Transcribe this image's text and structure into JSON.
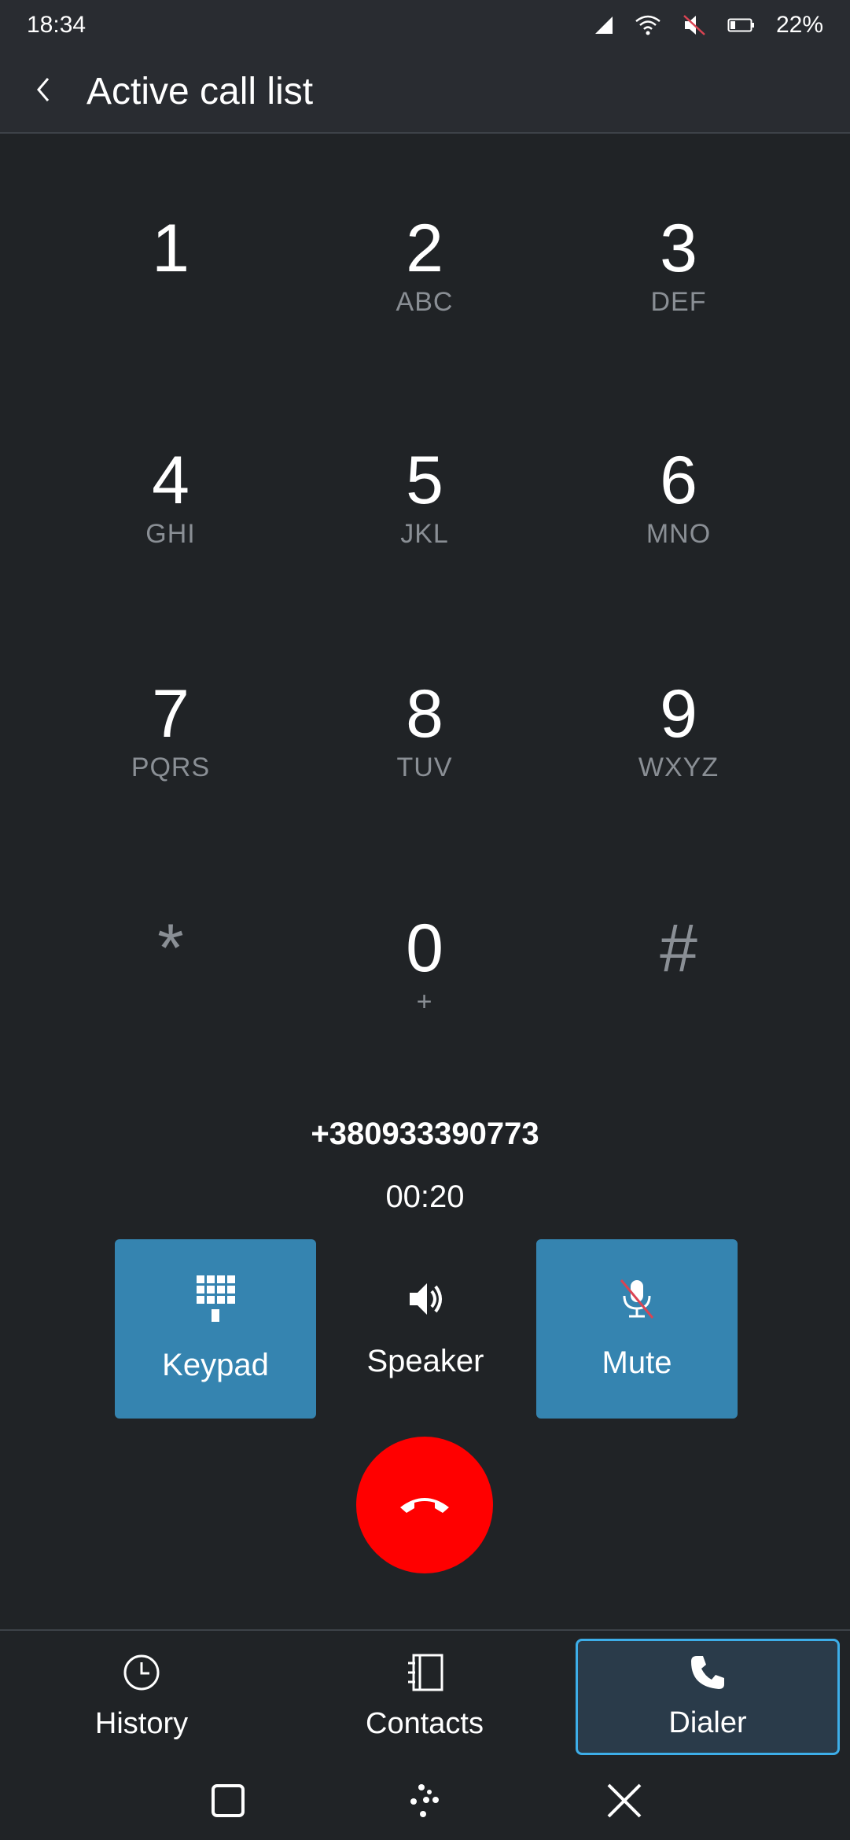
{
  "status": {
    "time": "18:34",
    "battery": "22%",
    "icons": [
      "signal-icon",
      "wifi-icon",
      "muted-speaker-icon",
      "battery-icon"
    ]
  },
  "header": {
    "title": "Active call list",
    "back_icon": "chevron-left-icon"
  },
  "keypad": [
    {
      "digit": "1",
      "letters": ""
    },
    {
      "digit": "2",
      "letters": "ABC"
    },
    {
      "digit": "3",
      "letters": "DEF"
    },
    {
      "digit": "4",
      "letters": "GHI"
    },
    {
      "digit": "5",
      "letters": "JKL"
    },
    {
      "digit": "6",
      "letters": "MNO"
    },
    {
      "digit": "7",
      "letters": "PQRS"
    },
    {
      "digit": "8",
      "letters": "TUV"
    },
    {
      "digit": "9",
      "letters": "WXYZ"
    },
    {
      "digit": "*",
      "letters": ""
    },
    {
      "digit": "0",
      "letters": "+"
    },
    {
      "digit": "#",
      "letters": ""
    }
  ],
  "call": {
    "number": "+380933390773",
    "duration": "00:20"
  },
  "actions": {
    "keypad": {
      "label": "Keypad",
      "icon": "dialpad-icon",
      "active": true
    },
    "speaker": {
      "label": "Speaker",
      "icon": "speaker-icon",
      "active": false
    },
    "mute": {
      "label": "Mute",
      "icon": "mic-off-icon",
      "active": true
    }
  },
  "hangup": {
    "icon": "hangup-icon",
    "color": "#ff0000"
  },
  "nav": {
    "history": {
      "label": "History",
      "icon": "clock-icon"
    },
    "contacts": {
      "label": "Contacts",
      "icon": "contacts-icon"
    },
    "dialer": {
      "label": "Dialer",
      "icon": "phone-icon",
      "selected": true
    }
  },
  "colors": {
    "background": "#202326",
    "accent": "#3584b0",
    "selection": "#3daee9",
    "hangup": "#ff0000"
  }
}
